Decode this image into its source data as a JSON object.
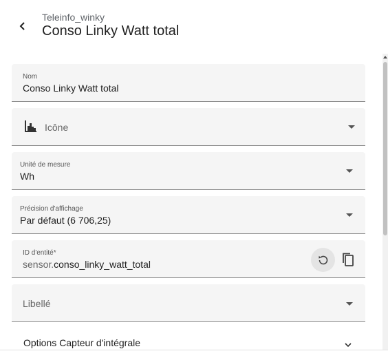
{
  "header": {
    "subtitle": "Teleinfo_winky",
    "title": "Conso Linky Watt total"
  },
  "fields": {
    "name": {
      "label": "Nom",
      "value": "Conso Linky Watt total"
    },
    "icon": {
      "placeholder": "Icône",
      "icon": "chart-histogram-icon"
    },
    "unit": {
      "label": "Unité de mesure",
      "value": "Wh"
    },
    "precision": {
      "label": "Précision d'affichage",
      "value": "Par défaut (6 706,25)"
    },
    "entity_id": {
      "label": "ID d'entité*",
      "prefix": "sensor.",
      "value": "conso_linky_watt_total"
    },
    "label": {
      "placeholder": "Libellé"
    }
  },
  "options": {
    "label": "Options Capteur d'intégrale"
  }
}
